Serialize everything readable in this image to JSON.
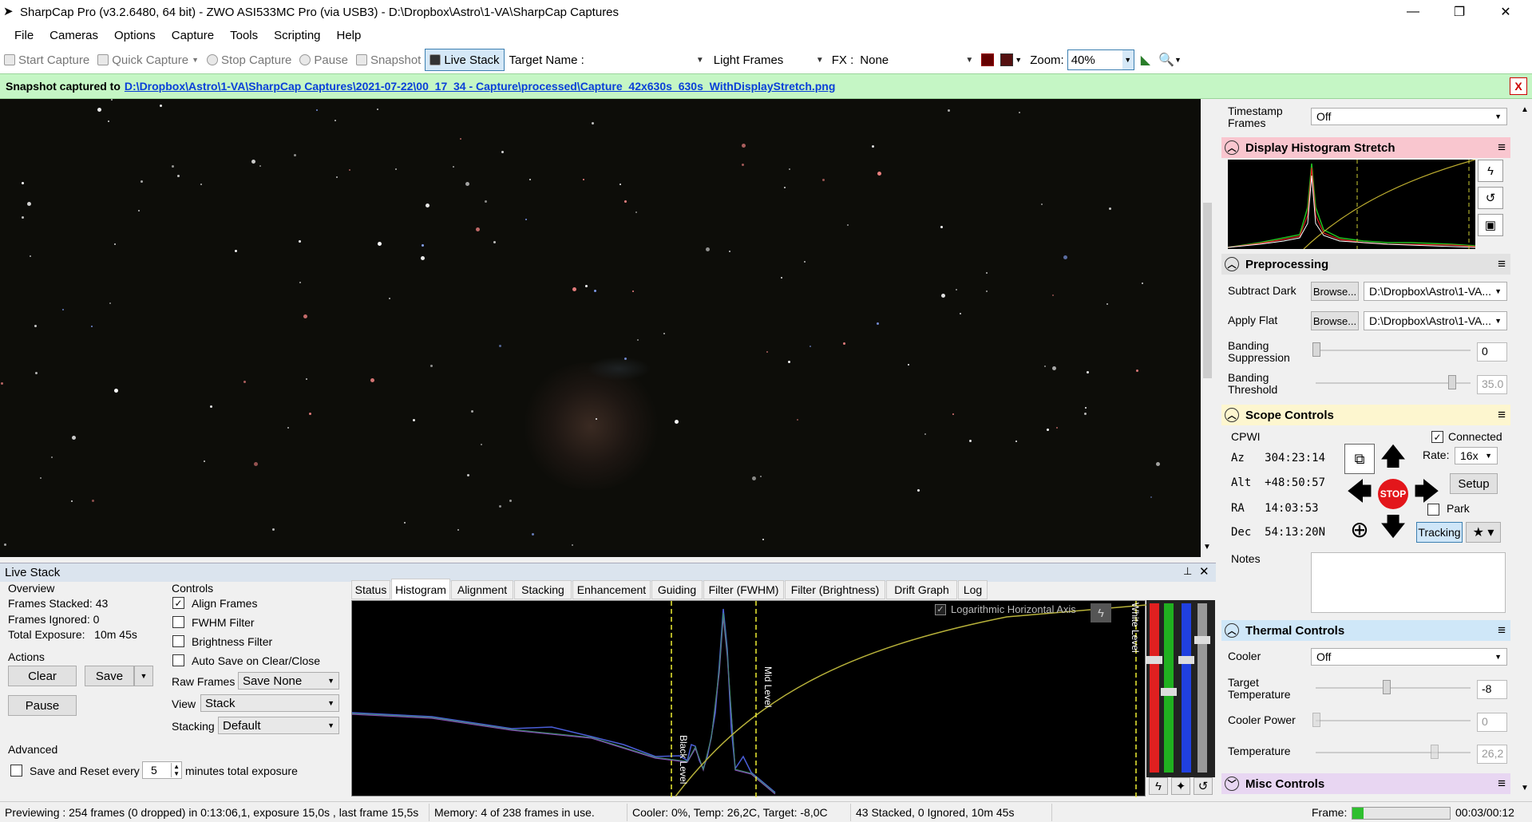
{
  "window": {
    "title": "SharpCap Pro (v3.2.6480, 64 bit) - ZWO ASI533MC Pro (via USB3) - D:\\Dropbox\\Astro\\1-VA\\SharpCap Captures",
    "minimize": "—",
    "maximize": "❐",
    "close": "✕"
  },
  "menu": [
    "File",
    "Cameras",
    "Options",
    "Capture",
    "Tools",
    "Scripting",
    "Help"
  ],
  "toolbar": {
    "start_capture": "Start Capture",
    "quick_capture": "Quick Capture",
    "stop_capture": "Stop Capture",
    "pause": "Pause",
    "snapshot": "Snapshot",
    "live_stack": "Live Stack",
    "target_name_label": "Target Name :",
    "target_name_value": "",
    "frame_type": "Light Frames",
    "fx_label": "FX :",
    "fx_value": "None",
    "zoom_label": "Zoom:",
    "zoom_value": "40%"
  },
  "notification": {
    "prefix": "Snapshot captured to",
    "path": "D:\\Dropbox\\Astro\\1-VA\\SharpCap Captures\\2021-07-22\\00_17_34 - Capture\\processed\\Capture_42x630s_630s_WithDisplayStretch.png",
    "close": "X"
  },
  "live_stack": {
    "title": "Live Stack",
    "pin": "📌",
    "close": "✕",
    "overview": {
      "heading": "Overview",
      "frames_stacked": "Frames Stacked: 43",
      "frames_ignored": "Frames Ignored:  0",
      "total_exposure": "Total Exposure:   10m 45s"
    },
    "actions": {
      "heading": "Actions",
      "clear": "Clear",
      "save": "Save",
      "pause": "Pause"
    },
    "controls": {
      "heading": "Controls",
      "align_frames": "Align Frames",
      "fwhm_filter": "FWHM Filter",
      "brightness_filter": "Brightness Filter",
      "auto_save": "Auto Save on Clear/Close",
      "raw_frames_label": "Raw Frames",
      "raw_frames_value": "Save None",
      "view_label": "View",
      "view_value": "Stack",
      "stacking_label": "Stacking",
      "stacking_value": "Default"
    },
    "advanced": {
      "heading": "Advanced",
      "save_reset_label": "Save and Reset every",
      "save_reset_value": "5",
      "save_reset_suffix": "minutes total exposure"
    },
    "tabs": [
      "Status",
      "Histogram",
      "Alignment",
      "Stacking",
      "Enhancement",
      "Guiding",
      "Filter (FWHM)",
      "Filter (Brightness)",
      "Drift Graph",
      "Log"
    ],
    "active_tab": "Histogram",
    "histogram": {
      "log_axis_label": "Logarithmic Horizontal Axis",
      "black_level": "Black Level",
      "mid_level": "Mid Level",
      "white_level": "White Level"
    }
  },
  "right_panel": {
    "timestamp_label": "Timestamp Frames",
    "timestamp_value": "Off",
    "display_histogram": {
      "title": "Display Histogram Stretch"
    },
    "preprocessing": {
      "title": "Preprocessing",
      "subtract_dark_label": "Subtract Dark",
      "browse": "Browse...",
      "subtract_dark_value": "D:\\Dropbox\\Astro\\1-VA...",
      "apply_flat_label": "Apply Flat",
      "apply_flat_value": "D:\\Dropbox\\Astro\\1-VA...",
      "banding_suppression_label": "Banding Suppression",
      "banding_suppression_value": "0",
      "banding_threshold_label": "Banding Threshold",
      "banding_threshold_value": "35.0"
    },
    "scope": {
      "title": "Scope Controls",
      "mount": "CPWI",
      "connected": "Connected",
      "az": "Az   304:23:14",
      "alt": "Alt  +48:50:57",
      "ra": "RA   14:03:53",
      "dec": "Dec  54:13:20N",
      "rate_label": "Rate:",
      "rate_value": "16x",
      "setup": "Setup",
      "park": "Park",
      "stop": "STOP",
      "tracking": "Tracking"
    },
    "notes_label": "Notes",
    "thermal": {
      "title": "Thermal Controls",
      "cooler_label": "Cooler",
      "cooler_value": "Off",
      "target_temp_label": "Target Temperature",
      "target_temp_value": "-8",
      "cooler_power_label": "Cooler Power",
      "cooler_power_value": "0",
      "temperature_label": "Temperature",
      "temperature_value": "26,2"
    },
    "misc": {
      "title": "Misc Controls"
    }
  },
  "status_bar": {
    "preview": "Previewing : 254 frames (0 dropped) in 0:13:06,1, exposure 15,0s , last frame 15,5s",
    "memory": "Memory: 4 of 238 frames in use.",
    "cooler": "Cooler: 0%, Temp: 26,2C, Target: -8,0C",
    "stacked": "43 Stacked, 0 Ignored, 10m 45s",
    "frame_label": "Frame:",
    "time": "00:03/00:12"
  },
  "colors": {
    "notif_bg": "#c5f6c5",
    "display_hist_header": "#f9c6cf",
    "preprocessing_header": "#e2e2e2",
    "scope_header": "#fdf6cf",
    "thermal_header": "#cfe7f8",
    "misc_header": "#e8d6f2"
  }
}
